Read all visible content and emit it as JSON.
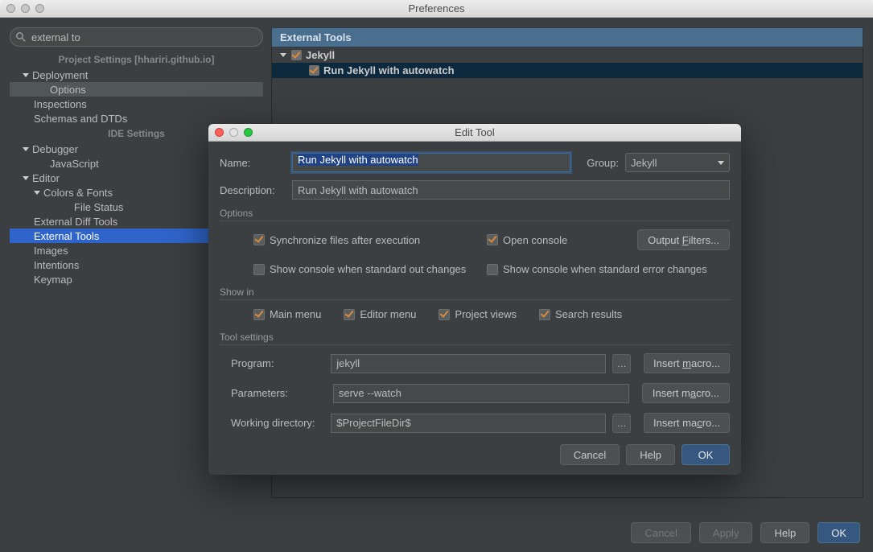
{
  "window": {
    "title": "Preferences"
  },
  "search": {
    "value": "external to"
  },
  "sidebar": {
    "proj_header": "Project Settings [hhariri.github.io]",
    "deployment": "Deployment",
    "options": "Options",
    "inspections": "Inspections",
    "schemas": "Schemas and DTDs",
    "ide_header": "IDE Settings",
    "debugger": "Debugger",
    "javascript": "JavaScript",
    "editor": "Editor",
    "colors_fonts": "Colors & Fonts",
    "file_status": "File Status",
    "ext_diff": "External Diff Tools",
    "ext_tools": "External Tools",
    "images": "Images",
    "intentions": "Intentions",
    "keymap": "Keymap"
  },
  "main": {
    "header": "External Tools",
    "jekyll": "Jekyll",
    "run_jekyll": "Run Jekyll with autowatch"
  },
  "modal": {
    "title": "Edit Tool",
    "name_label": "Name:",
    "name_value": "Run Jekyll with autowatch",
    "group_label": "Group:",
    "group_value": "Jekyll",
    "desc_label": "Description:",
    "desc_value": "Run Jekyll with autowatch",
    "options_label": "Options",
    "sync_label": "Synchronize files after execution",
    "open_console": "Open console",
    "output_filters": "Output Filters...",
    "show_stdout": "Show console when standard out changes",
    "show_stderr": "Show console when standard error changes",
    "show_in_label": "Show in",
    "main_menu": "Main menu",
    "editor_menu": "Editor menu",
    "project_views": "Project views",
    "search_results": "Search results",
    "tool_settings_label": "Tool settings",
    "program_label": "Program:",
    "program_value": "jekyll",
    "params_label": "Parameters:",
    "params_value": "serve --watch",
    "wd_label": "Working directory:",
    "wd_value": "$ProjectFileDir$",
    "insert_macro": "Insert macro...",
    "cancel": "Cancel",
    "help": "Help",
    "ok": "OK"
  },
  "footer": {
    "cancel": "Cancel",
    "apply": "Apply",
    "help": "Help",
    "ok": "OK"
  }
}
